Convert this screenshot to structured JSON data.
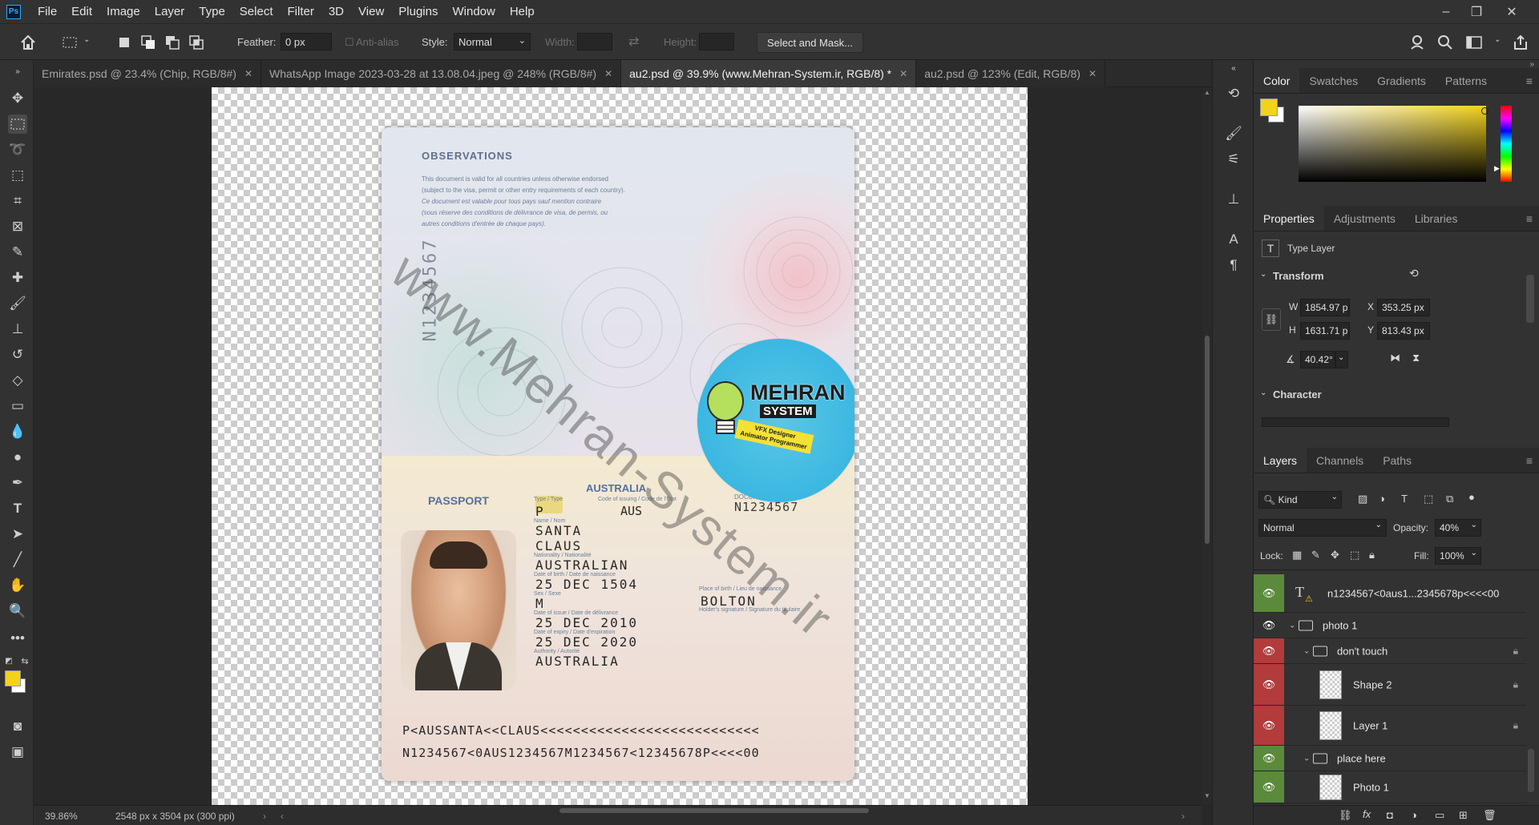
{
  "app": {
    "logo": "Ps",
    "menu": [
      "File",
      "Edit",
      "Image",
      "Layer",
      "Type",
      "Select",
      "Filter",
      "3D",
      "View",
      "Plugins",
      "Window",
      "Help"
    ],
    "window_controls": {
      "minimize": "–",
      "restore": "❐",
      "close": "✕"
    }
  },
  "options": {
    "feather_label": "Feather:",
    "feather_value": "0 px",
    "antialias_label": "Anti-alias",
    "style_label": "Style:",
    "style_value": "Normal",
    "width_label": "Width:",
    "height_label": "Height:",
    "select_mask_label": "Select and Mask..."
  },
  "tabs": [
    {
      "label": "Emirates.psd @ 23.4% (Chip, RGB/8#)",
      "active": false
    },
    {
      "label": "WhatsApp Image 2023-03-28 at 13.08.04.jpeg @ 248% (RGB/8#)",
      "active": false
    },
    {
      "label": "au2.psd @ 39.9% (www.Mehran-System.ir, RGB/8) *",
      "active": true
    },
    {
      "label": "au2.psd @ 123% (Edit, RGB/8)",
      "active": false
    }
  ],
  "document": {
    "observations_title": "OBSERVATIONS",
    "observations_lines": [
      "This document is valid for all countries unless otherwise endorsed",
      "(subject to the visa, permit or other entry requirements of each country).",
      "Ce document est valable pour tous pays sauf mention contraire",
      "(sous réserve des conditions de délivrance de visa, de permis, ou",
      "autres conditions d'entrée de chaque pays)."
    ],
    "vertical_number": "N1234567",
    "passport_label": "PASSPORT",
    "country_label": "AUSTRALIA",
    "document_no_label": "DOCUMENT No.",
    "document_no": "N1234567",
    "type_label": "Type / Type",
    "type": "P",
    "code_label": "Code of issuing / Code de l'État",
    "code": "AUS",
    "name_label": "Name / Nom",
    "surname": "SANTA",
    "given_name": "CLAUS",
    "nationality_label": "Nationality / Nationalité",
    "nationality": "AUSTRALIAN",
    "dob_label": "Date of birth / Date de naissance",
    "dob": "25 DEC 1504",
    "sex_label": "Sex / Sexe",
    "sex": "M",
    "pob_label": "Place of birth / Lieu de naissance",
    "pob": "BOLTON",
    "signature_label": "Holder's signature / Signature du titulaire",
    "issue_label": "Date of issue / Date de délivrance",
    "issue_date": "25 DEC 2010",
    "expiry_label": "Date of expiry / Date d'expiration",
    "expiry_date": "25 DEC 2020",
    "authority_label": "Authority / Autorité",
    "authority": "AUSTRALIA",
    "mrz1": "P<AUSSANTA<<CLAUS<<<<<<<<<<<<<<<<<<<<<<<<<<<",
    "mrz2": "N1234567<0AUS1234567M1234567<12345678P<<<<00",
    "watermark": "www.Mehran-System.ir",
    "logo_title": "MEHRAN",
    "logo_sub": "SYSTEM",
    "logo_tagline": "VFX Designer Animator Programmer"
  },
  "status": {
    "zoom": "39.86%",
    "doc_info": "2548 px x 3504 px (300 ppi)"
  },
  "color_panel": {
    "tabs": [
      "Color",
      "Swatches",
      "Gradients",
      "Patterns"
    ],
    "foreground": "#f2d21b",
    "background": "#ffffff"
  },
  "properties_panel": {
    "tabs": [
      "Properties",
      "Adjustments",
      "Libraries"
    ],
    "layer_type": "Type Layer",
    "transform_label": "Transform",
    "w_label": "W",
    "w_value": "1854.97 p",
    "h_label": "H",
    "h_value": "1631.71 p",
    "x_label": "X",
    "x_value": "353.25 px",
    "y_label": "Y",
    "y_value": "813.43 px",
    "angle_value": "40.42°",
    "character_label": "Character"
  },
  "layers_panel": {
    "tabs": [
      "Layers",
      "Channels",
      "Paths"
    ],
    "kind_label": "Kind",
    "blend_mode": "Normal",
    "opacity_label": "Opacity:",
    "opacity_value": "40%",
    "lock_label": "Lock:",
    "fill_label": "Fill:",
    "fill_value": "100%",
    "layers": [
      {
        "name": "n1234567<0aus1...2345678p<<<<00",
        "kind": "text",
        "eye": "green",
        "indent": 0,
        "locked": false
      },
      {
        "name": "photo 1",
        "kind": "group",
        "eye": "none",
        "indent": 0,
        "locked": false
      },
      {
        "name": "don't touch",
        "kind": "group",
        "eye": "red",
        "indent": 1,
        "locked": true
      },
      {
        "name": "Shape 2",
        "kind": "shape",
        "eye": "red",
        "indent": 2,
        "locked": true
      },
      {
        "name": "Layer 1",
        "kind": "pixel",
        "eye": "red",
        "indent": 2,
        "locked": true
      },
      {
        "name": "place here",
        "kind": "group",
        "eye": "green",
        "indent": 1,
        "locked": false
      },
      {
        "name": "Photo 1",
        "kind": "pixel",
        "eye": "green",
        "indent": 2,
        "locked": false
      }
    ]
  },
  "colors": {
    "eye_green": "#5a8a3a",
    "eye_red": "#b23b3b",
    "accent_blue": "#31a8ff"
  }
}
